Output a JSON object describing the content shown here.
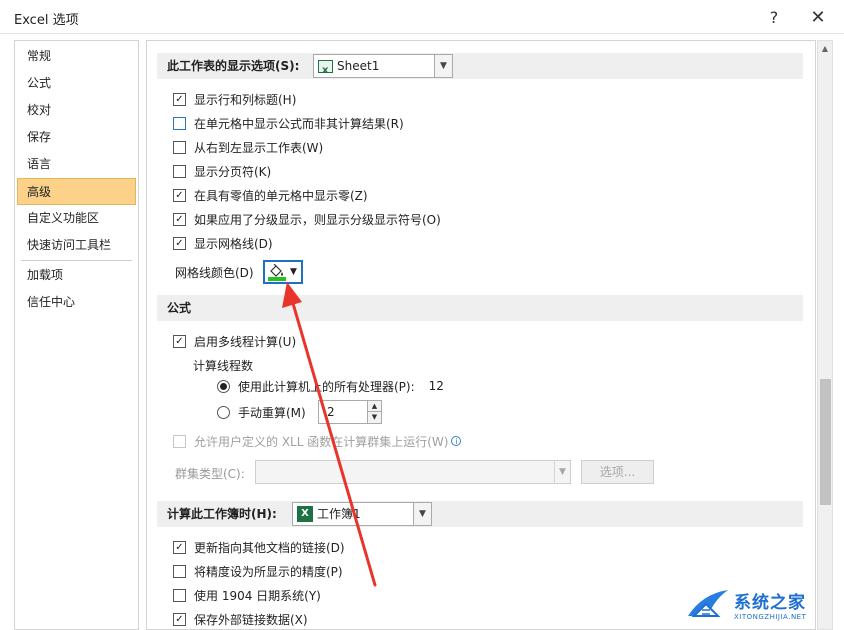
{
  "window": {
    "title": "Excel 选项",
    "help": "?",
    "close": "✕"
  },
  "nav": [
    {
      "label": "常规",
      "active": false
    },
    {
      "label": "公式",
      "active": false
    },
    {
      "label": "校对",
      "active": false
    },
    {
      "label": "保存",
      "active": false
    },
    {
      "label": "语言",
      "active": false
    },
    {
      "label": "高级",
      "active": true
    },
    {
      "label": "自定义功能区",
      "active": false
    },
    {
      "label": "快速访问工具栏",
      "active": false
    },
    {
      "label": "加载项",
      "active": false
    },
    {
      "label": "信任中心",
      "active": false
    }
  ],
  "sheet_section": {
    "title": "此工作表的显示选项(S):",
    "combo_value": "Sheet1",
    "options": [
      {
        "label": "显示行和列标题(H)",
        "checked": true
      },
      {
        "label": "在单元格中显示公式而非其计算结果(R)",
        "checked": false
      },
      {
        "label": "从右到左显示工作表(W)",
        "checked": false
      },
      {
        "label": "显示分页符(K)",
        "checked": false
      },
      {
        "label": "在具有零值的单元格中显示零(Z)",
        "checked": true
      },
      {
        "label": "如果应用了分级显示，则显示分级显示符号(O)",
        "checked": true
      },
      {
        "label": "显示网格线(D)",
        "checked": true
      }
    ],
    "gridline_color_label": "网格线颜色(D)",
    "gridline_color": "#22c21f"
  },
  "formula_section": {
    "title": "公式",
    "multithread_label": "启用多线程计算(U)",
    "multithread_checked": true,
    "threads_label": "计算线程数",
    "radio_all_label": "使用此计算机上的所有处理器(P):",
    "radio_all_value": "12",
    "radio_manual_label": "手动重算(M)",
    "manual_value": "2",
    "xll_label": "允许用户定义的 XLL 函数在计算群集上运行(W)",
    "cluster_type_label": "群集类型(C):",
    "options_button": "选项..."
  },
  "calc_section": {
    "title": "计算此工作簿时(H):",
    "combo_value": "工作簿1",
    "options": [
      {
        "label": "更新指向其他文档的链接(D)",
        "checked": true
      },
      {
        "label": "将精度设为所显示的精度(P)",
        "checked": false
      },
      {
        "label": "使用 1904 日期系统(Y)",
        "checked": false
      },
      {
        "label": "保存外部链接数据(X)",
        "checked": true
      }
    ]
  },
  "watermark": {
    "main": "系统之家",
    "sub": "XITONGZHIJIA.NET"
  },
  "colors": {
    "accent": "#1f6fc5",
    "nav_active": "#fcd28a",
    "annotation_arrow": "#e8342a"
  }
}
